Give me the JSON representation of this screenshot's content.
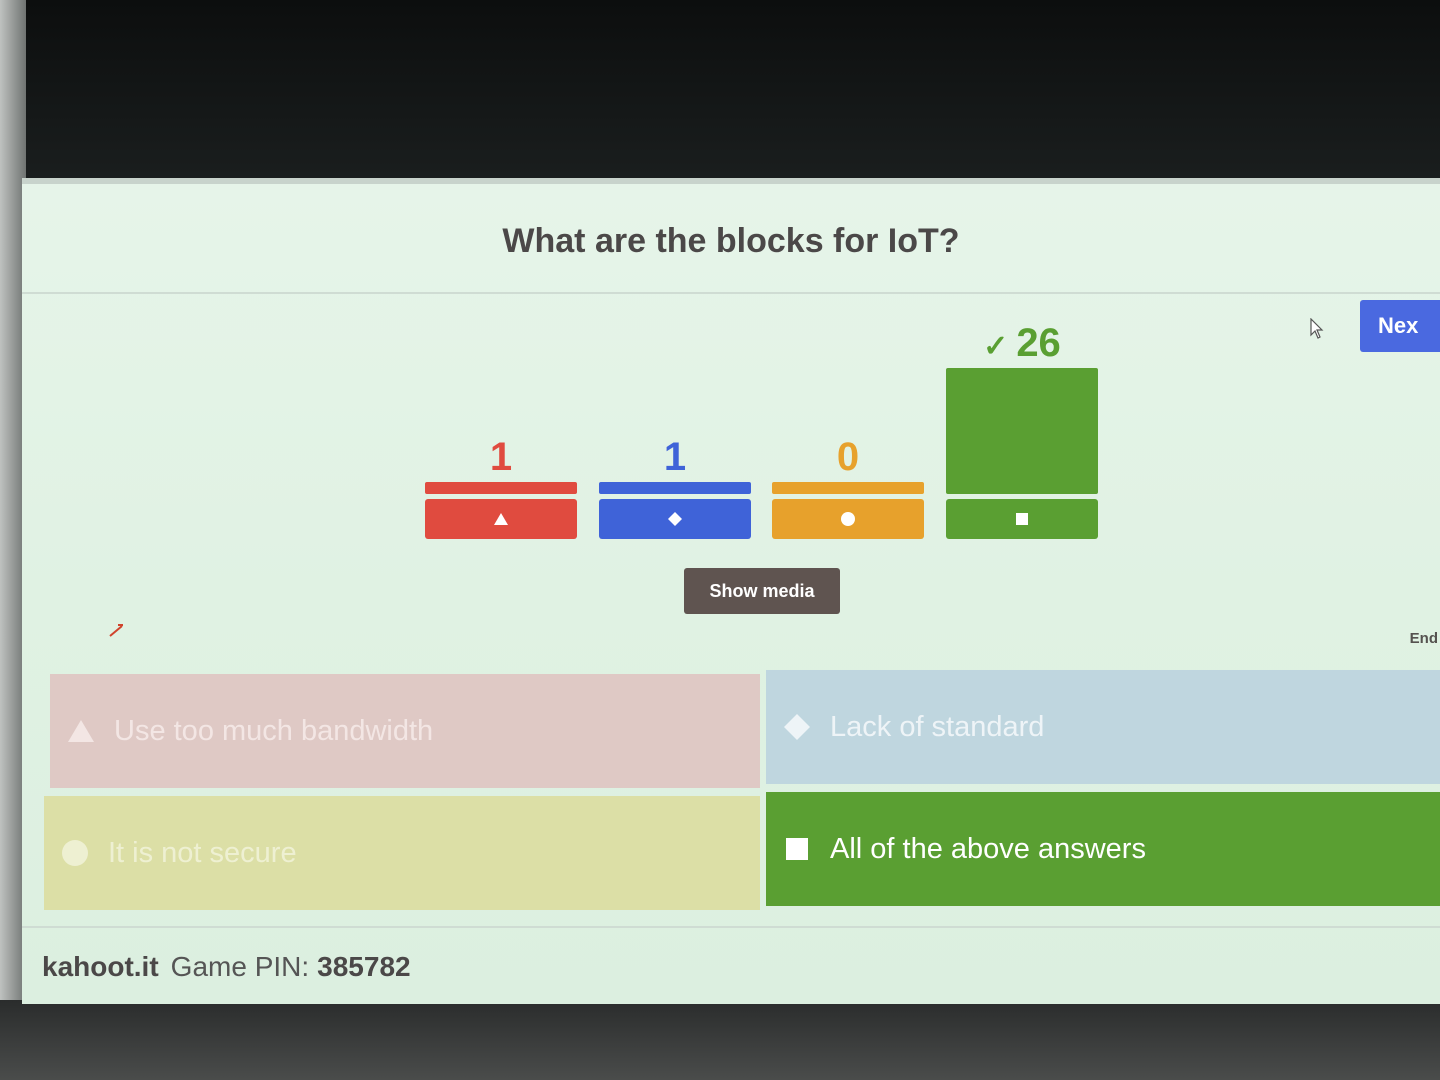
{
  "question": {
    "title": "What are the blocks for IoT?"
  },
  "controls": {
    "next_label": "Nex",
    "show_media_label": "Show media",
    "end_label": "End"
  },
  "results": [
    {
      "count": "1",
      "value": 1,
      "color": "#e04b3f",
      "shape": "triangle-icon",
      "correct": false
    },
    {
      "count": "1",
      "value": 1,
      "color": "#3f63d8",
      "shape": "diamond-icon",
      "correct": false
    },
    {
      "count": "0",
      "value": 0,
      "color": "#e7a12c",
      "shape": "circle-icon",
      "correct": false
    },
    {
      "count": "26",
      "value": 26,
      "color": "#5a9f32",
      "shape": "square-icon",
      "correct": true
    }
  ],
  "correct_mark": "✓",
  "answers": [
    {
      "text": "Use too much bandwidth",
      "shape": "triangle-icon",
      "bg": "#dfc9c5",
      "fg": "#f3e6e4"
    },
    {
      "text": "Lack of standard",
      "shape": "diamond-icon",
      "bg": "#bfd6df",
      "fg": "#eef4f7"
    },
    {
      "text": "It is not secure",
      "shape": "circle-icon",
      "bg": "#dcdfa6",
      "fg": "#eef0d2"
    },
    {
      "text": "All of the above answers",
      "shape": "square-icon",
      "bg": "#5a9f32",
      "fg": "#ffffff"
    }
  ],
  "footer": {
    "brand": "kahoot.it",
    "pin_label": "Game PIN:",
    "pin_value": "385782"
  }
}
